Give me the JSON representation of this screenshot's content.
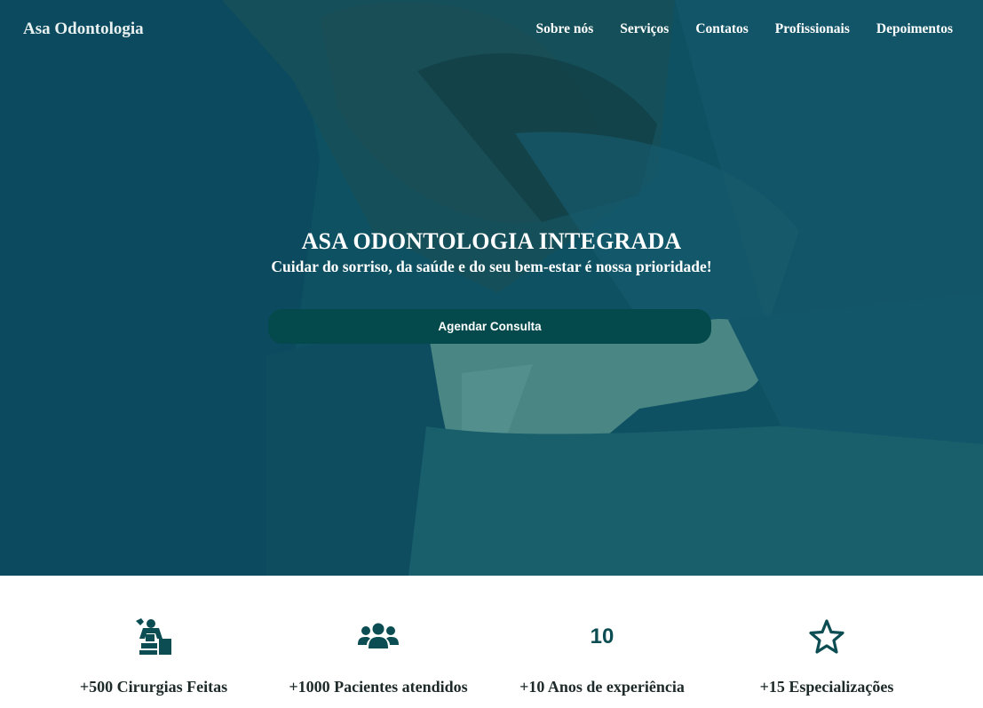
{
  "nav": {
    "brand": "Asa Odontologia",
    "links": [
      "Sobre nós",
      "Serviços",
      "Contatos",
      "Profissionais",
      "Depoimentos"
    ]
  },
  "hero": {
    "title": "ASA ODONTOLOGIA INTEGRADA",
    "subtitle": "Cuidar do sorriso, da saúde e do seu bem-estar é nossa prioridade!",
    "cta": "Agendar Consulta"
  },
  "stats": [
    {
      "icon": "surgery-icon",
      "label": "+500 Cirurgias Feitas"
    },
    {
      "icon": "users-icon",
      "label": "+1000 Pacientes atendidos"
    },
    {
      "icon": "number-10-icon",
      "label": "+10 Anos de experiência",
      "icon_text": "10"
    },
    {
      "icon": "star-icon",
      "label": "+15 Especializações"
    }
  ],
  "colors": {
    "accent": "#044a4c",
    "overlay": "#0d4f5c",
    "icon": "#0b4d52"
  }
}
